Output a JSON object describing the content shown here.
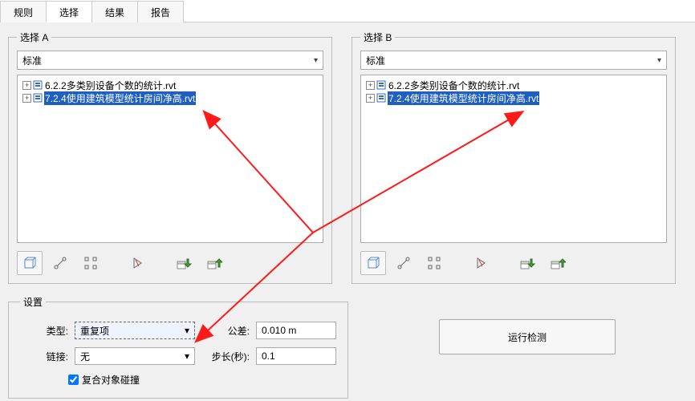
{
  "tabs": {
    "rules": "规则",
    "select": "选择",
    "results": "结果",
    "report": "报告",
    "active": "select"
  },
  "selectA": {
    "legend": "选择 A",
    "combo": "标准",
    "tree": {
      "items": [
        {
          "label": "6.2.2多类别设备个数的统计.rvt",
          "selected": false
        },
        {
          "label": "7.2.4使用建筑模型统计房间净高.rvt",
          "selected": true
        }
      ]
    }
  },
  "selectB": {
    "legend": "选择 B",
    "combo": "标准",
    "tree": {
      "items": [
        {
          "label": "6.2.2多类别设备个数的统计.rvt",
          "selected": false
        },
        {
          "label": "7.2.4使用建筑模型统计房间净高.rvt",
          "selected": true
        }
      ]
    }
  },
  "toolbar_icons": {
    "cube": "cube-icon",
    "line": "line-icon",
    "nodes": "nodes-icon",
    "play": "play-icon",
    "load": "load-icon",
    "save": "save-icon"
  },
  "settings": {
    "legend": "设置",
    "type_label": "类型:",
    "type_value": "重复项",
    "tolerance_label": "公差:",
    "tolerance_value": "0.010 m",
    "link_label": "链接:",
    "link_value": "无",
    "step_label": "步长(秒):",
    "step_value": "0.1",
    "checkbox_label": "复合对象碰撞"
  },
  "run_button": "运行检测"
}
